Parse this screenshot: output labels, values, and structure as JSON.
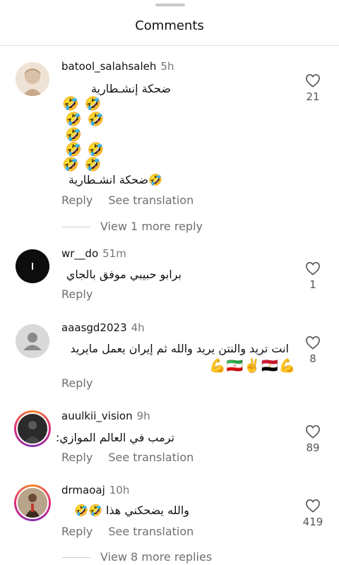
{
  "header": {
    "title": "Comments"
  },
  "comments": [
    {
      "username": "batool_salahsaleh",
      "time": "5h",
      "text_lines": [
        "ضحكة إنشـطارية"
      ],
      "emoji_lines": [
        "🤣 🤣",
        "🤣 🤣",
        "🤣",
        "🤣 🤣",
        "🤣 🤣"
      ],
      "text_lines2": [
        "🤣ضحكة انشـطارية"
      ],
      "reply": "Reply",
      "translate": "See translation",
      "likes": "21",
      "more_replies": "View 1 more reply"
    },
    {
      "username": "wr__do",
      "time": "51m",
      "text_lines": [
        "برابو حبيبي موفق بالجاي"
      ],
      "reply": "Reply",
      "likes": "1"
    },
    {
      "username": "aaasgd2023",
      "time": "4h",
      "text_lines": [
        "انت تريد والنتن يريد والله ثم إيران يعمل مايريد"
      ],
      "emoji_lines": [
        "💪🇮🇷✌️🇪🇬💪"
      ],
      "reply": "Reply",
      "likes": "8"
    },
    {
      "username": "auulkii_vision",
      "time": "9h",
      "text_lines": [
        "ترمب في العالم الموازي:"
      ],
      "reply": "Reply",
      "translate": "See translation",
      "likes": "89"
    },
    {
      "username": "drmaoaj",
      "time": "10h",
      "text_lines": [
        "والله يضحكني هذا 🤣🤣"
      ],
      "reply": "Reply",
      "translate": "See translation",
      "likes": "419",
      "more_replies": "View 8 more replies"
    }
  ],
  "colors": {
    "secondary_text": "#6f6f6f",
    "story_ring": "#dd2a7b"
  }
}
